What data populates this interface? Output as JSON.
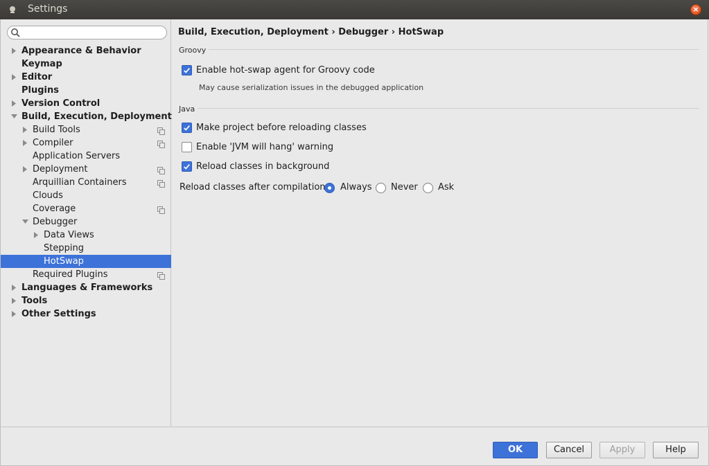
{
  "window": {
    "title": "Settings"
  },
  "search": {
    "value": "",
    "placeholder": ""
  },
  "tree": [
    {
      "label": "Appearance & Behavior",
      "bold": true,
      "level": 0,
      "arrow": "right",
      "page_icon": false,
      "selected": false
    },
    {
      "label": "Keymap",
      "bold": true,
      "level": 0,
      "arrow": "none",
      "page_icon": false,
      "selected": false
    },
    {
      "label": "Editor",
      "bold": true,
      "level": 0,
      "arrow": "right",
      "page_icon": false,
      "selected": false
    },
    {
      "label": "Plugins",
      "bold": true,
      "level": 0,
      "arrow": "none",
      "page_icon": false,
      "selected": false
    },
    {
      "label": "Version Control",
      "bold": true,
      "level": 0,
      "arrow": "right",
      "page_icon": false,
      "selected": false
    },
    {
      "label": "Build, Execution, Deployment",
      "bold": true,
      "level": 0,
      "arrow": "down",
      "page_icon": false,
      "selected": false
    },
    {
      "label": "Build Tools",
      "bold": false,
      "level": 1,
      "arrow": "right",
      "page_icon": true,
      "selected": false
    },
    {
      "label": "Compiler",
      "bold": false,
      "level": 1,
      "arrow": "right",
      "page_icon": true,
      "selected": false
    },
    {
      "label": "Application Servers",
      "bold": false,
      "level": 1,
      "arrow": "none",
      "page_icon": false,
      "selected": false
    },
    {
      "label": "Deployment",
      "bold": false,
      "level": 1,
      "arrow": "right",
      "page_icon": true,
      "selected": false
    },
    {
      "label": "Arquillian Containers",
      "bold": false,
      "level": 1,
      "arrow": "none",
      "page_icon": true,
      "selected": false
    },
    {
      "label": "Clouds",
      "bold": false,
      "level": 1,
      "arrow": "none",
      "page_icon": false,
      "selected": false
    },
    {
      "label": "Coverage",
      "bold": false,
      "level": 1,
      "arrow": "none",
      "page_icon": true,
      "selected": false
    },
    {
      "label": "Debugger",
      "bold": false,
      "level": 1,
      "arrow": "down",
      "page_icon": false,
      "selected": false
    },
    {
      "label": "Data Views",
      "bold": false,
      "level": 2,
      "arrow": "right",
      "page_icon": false,
      "selected": false
    },
    {
      "label": "Stepping",
      "bold": false,
      "level": 2,
      "arrow": "none",
      "page_icon": false,
      "selected": false
    },
    {
      "label": "HotSwap",
      "bold": false,
      "level": 2,
      "arrow": "none",
      "page_icon": false,
      "selected": true
    },
    {
      "label": "Required Plugins",
      "bold": false,
      "level": 1,
      "arrow": "none",
      "page_icon": true,
      "selected": false
    },
    {
      "label": "Languages & Frameworks",
      "bold": true,
      "level": 0,
      "arrow": "right",
      "page_icon": false,
      "selected": false
    },
    {
      "label": "Tools",
      "bold": true,
      "level": 0,
      "arrow": "right",
      "page_icon": false,
      "selected": false
    },
    {
      "label": "Other Settings",
      "bold": true,
      "level": 0,
      "arrow": "right",
      "page_icon": false,
      "selected": false
    }
  ],
  "content": {
    "breadcrumb": "Build, Execution, Deployment › Debugger › HotSwap",
    "groovy": {
      "title": "Groovy",
      "enable_agent": {
        "label": "Enable hot-swap agent for Groovy code",
        "checked": true
      },
      "hint": "May cause serialization issues in the debugged application"
    },
    "java": {
      "title": "Java",
      "make_project": {
        "label": "Make project before reloading classes",
        "checked": true
      },
      "jvm_hang": {
        "label": "Enable 'JVM will hang' warning",
        "checked": false
      },
      "reload_background": {
        "label": "Reload classes in background",
        "checked": true
      },
      "reload_after": {
        "label": "Reload classes after compilation:",
        "options": [
          "Always",
          "Never",
          "Ask"
        ],
        "selected": "Always"
      }
    }
  },
  "footer": {
    "ok": "OK",
    "cancel": "Cancel",
    "apply": "Apply",
    "help": "Help"
  },
  "colors": {
    "accent": "#3d72d8",
    "title_bar": "#3b3a36",
    "close_button": "#e2531e"
  }
}
